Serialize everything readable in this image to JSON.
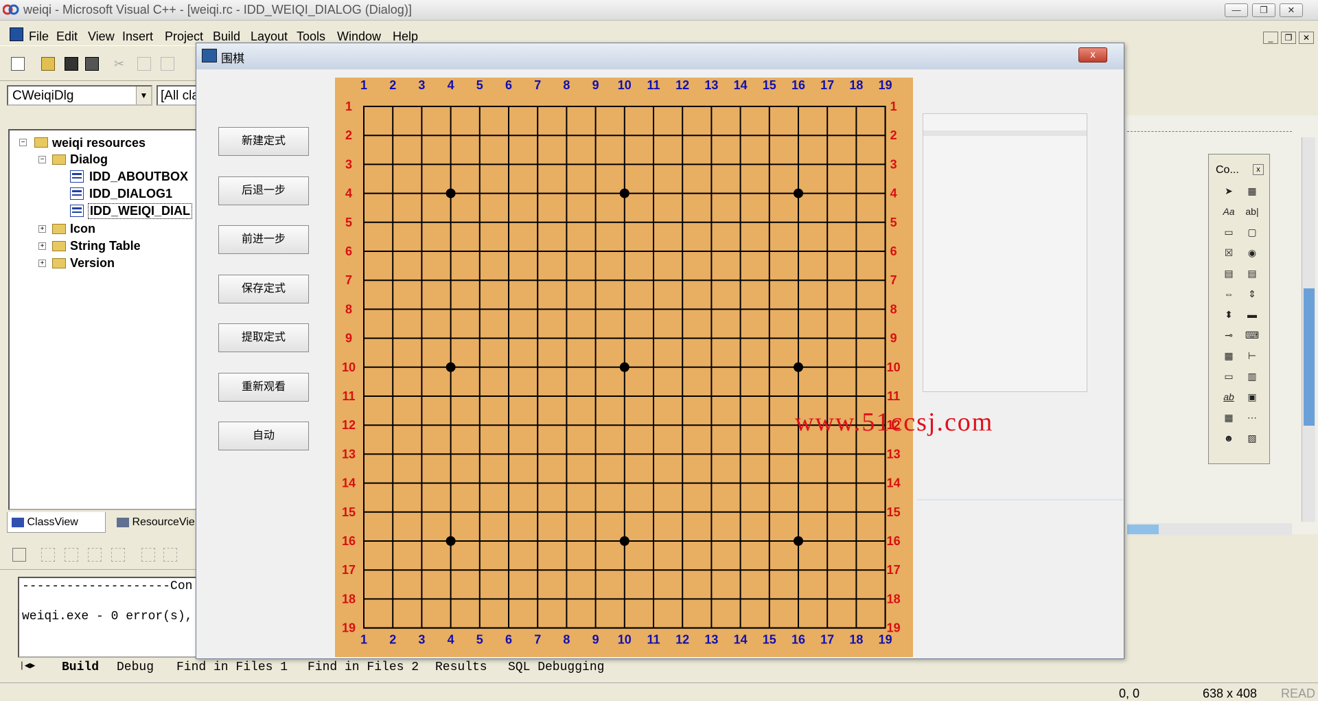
{
  "app": {
    "title": "weiqi - Microsoft Visual C++ - [weiqi.rc - IDD_WEIQI_DIALOG (Dialog)]",
    "menu": [
      "File",
      "Edit",
      "View",
      "Insert",
      "Project",
      "Build",
      "Layout",
      "Tools",
      "Window",
      "Help"
    ],
    "class_combo": "CWeiqiDlg",
    "members_combo": "[All cla"
  },
  "tree": {
    "root": "weiqi resources",
    "dialog_folder": "Dialog",
    "items": [
      "IDD_ABOUTBOX",
      "IDD_DIALOG1",
      "IDD_WEIQI_DIAL"
    ],
    "folders": [
      "Icon",
      "String Table",
      "Version"
    ]
  },
  "workspace_tabs": [
    "ClassView",
    "ResourceVie"
  ],
  "output": {
    "line1": "--------------------Con",
    "line2": "weiqi.exe - 0 error(s),",
    "tabs": [
      "Build",
      "Debug",
      "Find in Files 1",
      "Find in Files 2",
      "Results",
      "SQL Debugging"
    ]
  },
  "status": {
    "position": "0, 0",
    "size": "638 x 408",
    "mode": "READ"
  },
  "controls_toolbox": {
    "title": "Co...",
    "close": "x"
  },
  "dialog": {
    "title": "围棋",
    "close": "x",
    "buttons": [
      "新建定式",
      "后退一步",
      "前进一步",
      "保存定式",
      "提取定式",
      "重新观看",
      "自动"
    ]
  },
  "board": {
    "size": 19,
    "col_labels": [
      "1",
      "2",
      "3",
      "4",
      "5",
      "6",
      "7",
      "8",
      "9",
      "10",
      "11",
      "12",
      "13",
      "14",
      "15",
      "16",
      "17",
      "18",
      "19"
    ],
    "row_labels": [
      "1",
      "2",
      "3",
      "4",
      "5",
      "6",
      "7",
      "8",
      "9",
      "10",
      "11",
      "12",
      "13",
      "14",
      "15",
      "16",
      "17",
      "18",
      "19"
    ],
    "star_points": [
      [
        4,
        4
      ],
      [
        10,
        4
      ],
      [
        16,
        4
      ],
      [
        4,
        10
      ],
      [
        10,
        10
      ],
      [
        16,
        10
      ],
      [
        4,
        16
      ],
      [
        10,
        16
      ],
      [
        16,
        16
      ]
    ],
    "colors": {
      "board": "#e8ae62",
      "col_label": "#1010b0",
      "row_label": "#d81010",
      "line": "#000000"
    },
    "watermark": "www.51ccsj.com"
  }
}
